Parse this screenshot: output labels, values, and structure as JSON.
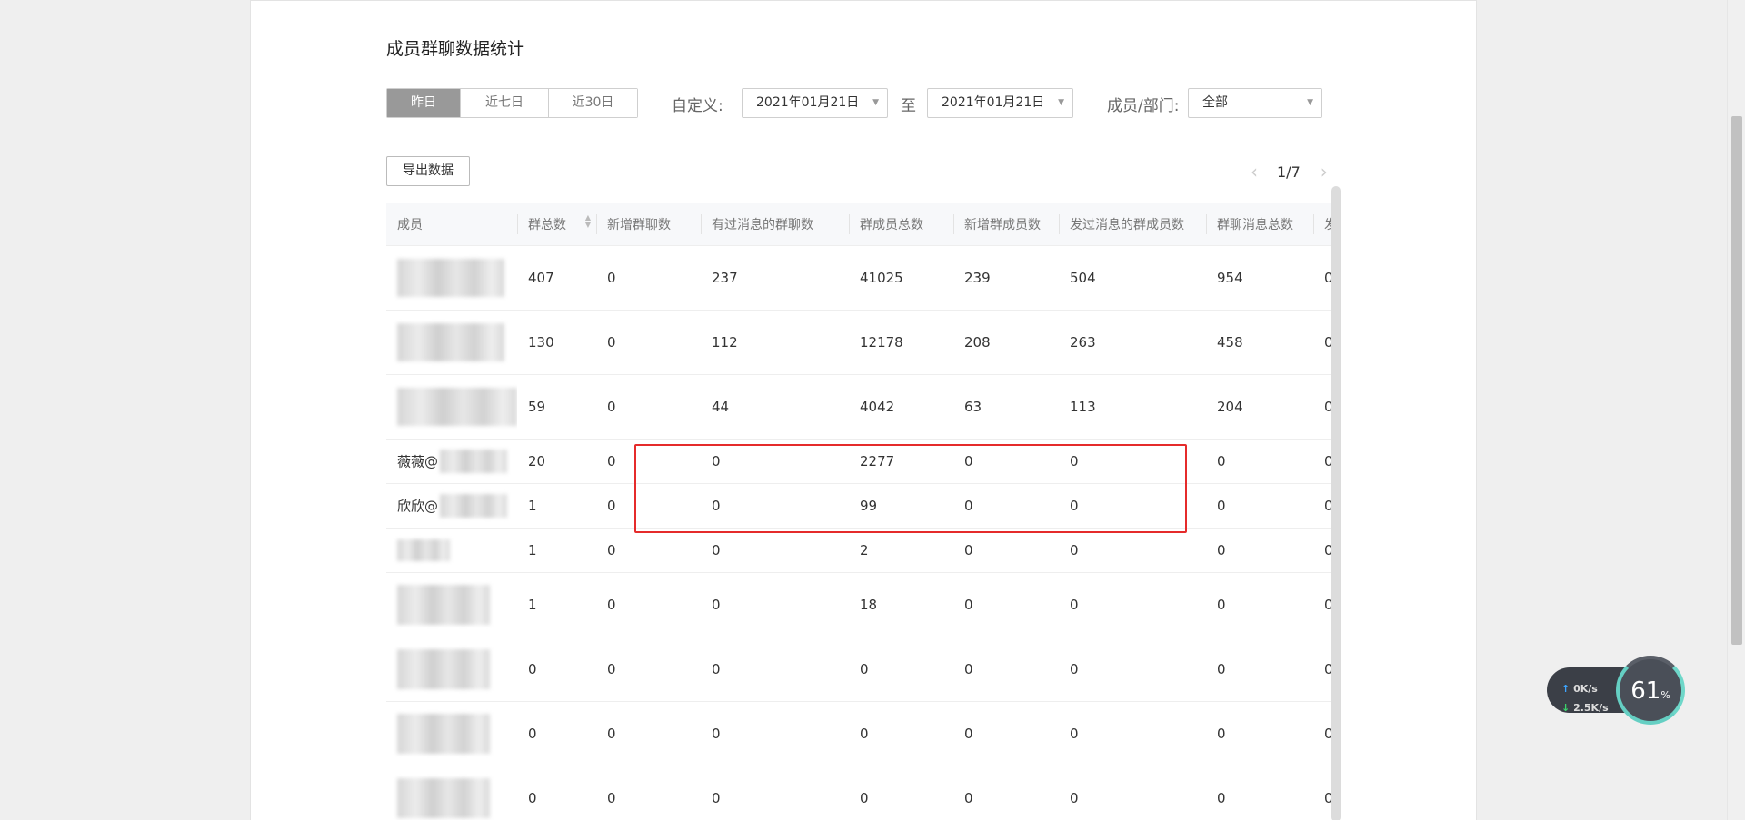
{
  "page": {
    "title": "成员群聊数据统计"
  },
  "filters": {
    "ranges": [
      "昨日",
      "近七日",
      "近30日"
    ],
    "active_range": "昨日",
    "custom_label": "自定义:",
    "start_date": "2021年01月21日",
    "to_label": "至",
    "end_date": "2021年01月21日",
    "member_label": "成员/部门:",
    "member_value": "全部"
  },
  "toolbar": {
    "export_label": "导出数据"
  },
  "pager": {
    "page": "1/7"
  },
  "table": {
    "columns": [
      "成员",
      "群总数",
      "新增群聊数",
      "有过消息的群聊数",
      "群成员总数",
      "新增群成员数",
      "发过消息的群成员数",
      "群聊消息总数",
      "发"
    ],
    "rows": [
      {
        "name": "",
        "values": [
          "407",
          "0",
          "237",
          "41025",
          "239",
          "504",
          "954",
          "0"
        ]
      },
      {
        "name": "",
        "values": [
          "130",
          "0",
          "112",
          "12178",
          "208",
          "263",
          "458",
          "0"
        ]
      },
      {
        "name": "",
        "values": [
          "59",
          "0",
          "44",
          "4042",
          "63",
          "113",
          "204",
          "0"
        ]
      },
      {
        "name": "薇薇@",
        "values": [
          "20",
          "0",
          "0",
          "2277",
          "0",
          "0",
          "0",
          "0"
        ]
      },
      {
        "name": "欣欣@",
        "values": [
          "1",
          "0",
          "0",
          "99",
          "0",
          "0",
          "0",
          "0"
        ]
      },
      {
        "name": "",
        "values": [
          "1",
          "0",
          "0",
          "2",
          "0",
          "0",
          "0",
          "0"
        ]
      },
      {
        "name": "",
        "values": [
          "1",
          "0",
          "0",
          "18",
          "0",
          "0",
          "0",
          "0"
        ]
      },
      {
        "name": "",
        "values": [
          "0",
          "0",
          "0",
          "0",
          "0",
          "0",
          "0",
          "0"
        ]
      },
      {
        "name": "",
        "values": [
          "0",
          "0",
          "0",
          "0",
          "0",
          "0",
          "0",
          "0"
        ]
      },
      {
        "name": "",
        "values": [
          "0",
          "0",
          "0",
          "0",
          "0",
          "0",
          "0",
          "0"
        ]
      }
    ]
  },
  "net_widget": {
    "upload": "0K/s",
    "download": "2.5K/s",
    "percent": "61",
    "percent_unit": "%"
  },
  "colors": {
    "highlight": "#e52b2b",
    "active_tab": "#999999",
    "widget_ring": "#65cfc3"
  }
}
